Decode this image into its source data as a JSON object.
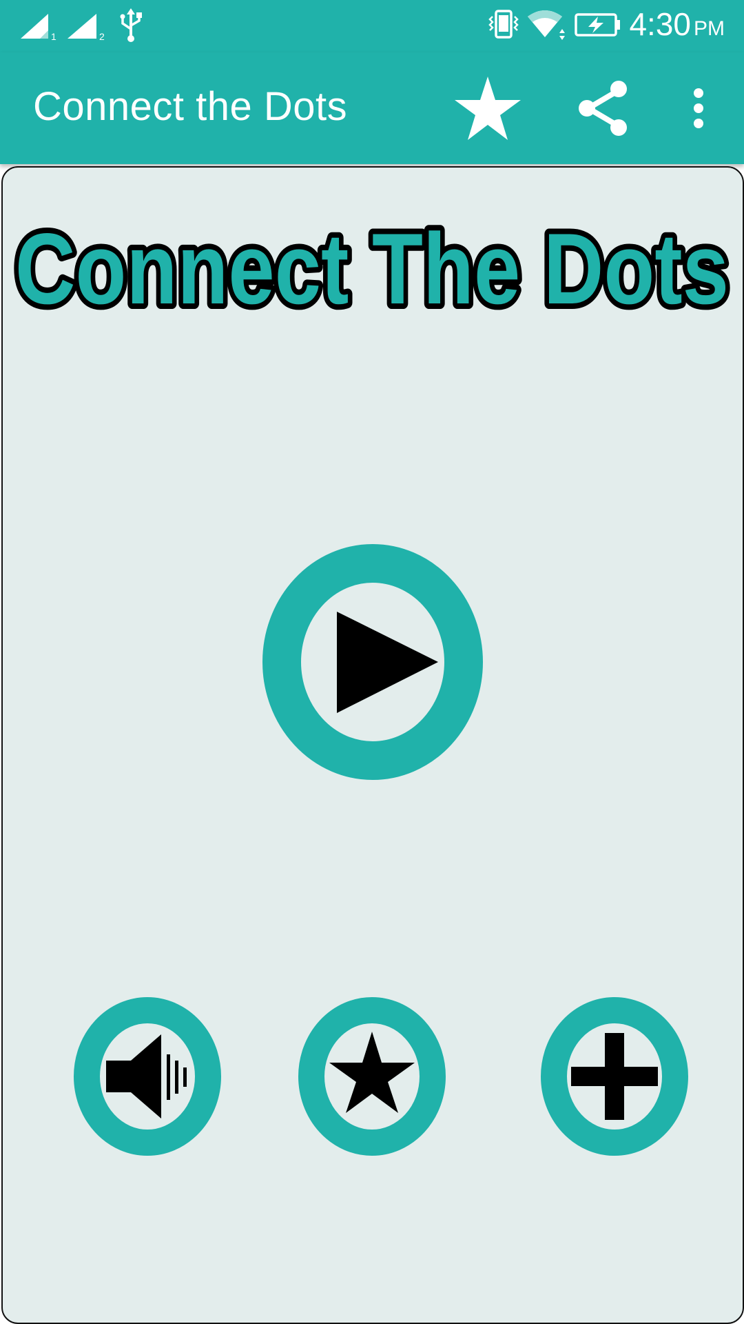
{
  "status_bar": {
    "time": "4:30",
    "ampm": "PM",
    "sim1_label": "1",
    "sim2_label": "2",
    "icons": [
      "signal-sim1-icon",
      "signal-sim2-icon",
      "usb-icon",
      "vibrate-icon",
      "wifi-icon",
      "battery-charging-icon"
    ]
  },
  "app_bar": {
    "title": "Connect the Dots",
    "actions": [
      "star-icon",
      "share-icon",
      "overflow-menu-icon"
    ]
  },
  "main": {
    "logo_text": "Connect The Dots",
    "buttons": [
      "play-icon",
      "sound-icon",
      "star-icon",
      "plus-icon"
    ]
  },
  "colors": {
    "accent": "#20b2aa",
    "background": "#e3edec",
    "icon": "#000000",
    "bar_text": "#ffffff"
  }
}
